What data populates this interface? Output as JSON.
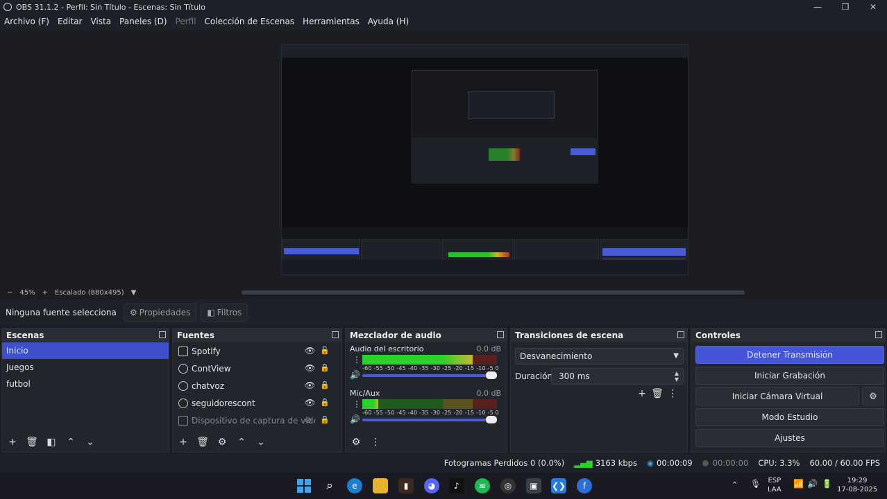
{
  "window": {
    "title": "OBS 31.1.2 - Perfil: Sin Título - Escenas: Sin Título",
    "minimize_icon": "minimize-icon",
    "maximize_icon": "maximize-icon",
    "close_icon": "close-icon"
  },
  "menu": {
    "items": [
      "Archivo (F)",
      "Editar",
      "Vista",
      "Paneles (D)",
      "Perfil",
      "Colección de Escenas",
      "Herramientas",
      "Ayuda (H)"
    ]
  },
  "zoom": {
    "minus": "−",
    "level": "45%",
    "plus": "+",
    "scaling": "Escalado (880x495)"
  },
  "source_toolbar": {
    "no_selection": "Ninguna fuente selecciona",
    "properties": "Propiedades",
    "filters": "Filtros"
  },
  "scenes": {
    "title": "Escenas",
    "items": [
      "Inicio",
      "Juegos",
      "futbol"
    ],
    "selected_index": 0
  },
  "sources": {
    "title": "Fuentes",
    "items": [
      {
        "name": "Spotify",
        "icon": "window-capture-icon",
        "visible": true,
        "locked": false
      },
      {
        "name": "ContView",
        "icon": "browser-source-icon",
        "visible": true,
        "locked": true
      },
      {
        "name": "chatvoz",
        "icon": "browser-source-icon",
        "visible": true,
        "locked": true
      },
      {
        "name": "seguidorescont",
        "icon": "browser-source-icon",
        "visible": true,
        "locked": true
      },
      {
        "name": "Dispositivo de captura de video",
        "icon": "camera-icon",
        "visible": false,
        "locked": true
      }
    ]
  },
  "mixer": {
    "title": "Mezclador de audio",
    "channels": [
      {
        "name": "Audio del escritorio",
        "db": "0.0 dB",
        "level": 0.82
      },
      {
        "name": "Mic/Aux",
        "db": "0.0 dB",
        "level": 0.12
      }
    ],
    "ticks": "-60 -55 -50 -45 -40 -35 -30 -25 -20 -15 -10  -5   0"
  },
  "transitions": {
    "title": "Transiciones de escena",
    "selected": "Desvanecimiento",
    "duration_label": "Duración",
    "duration_value": "300 ms"
  },
  "controls": {
    "title": "Controles",
    "stop_stream": "Detener Transmisión",
    "start_recording": "Iniciar Grabación",
    "start_virtual_cam": "Iniciar Cámara Virtual",
    "studio_mode": "Modo Estudio",
    "settings": "Ajustes"
  },
  "status": {
    "dropped_frames": "Fotogramas Perdidos 0 (0.0%)",
    "bitrate": "3163 kbps",
    "stream_time": "00:00:09",
    "record_time": "00:00:00",
    "cpu": "CPU: 3.3%",
    "fps": "60.00 / 60.00 FPS"
  },
  "taskbar": {
    "lang_top": "ESP",
    "lang_bottom": "LAA",
    "time": "19:29",
    "date": "17-08-2025"
  },
  "colors": {
    "accent": "#4455d6",
    "selection": "#3d50c9",
    "meter_green": "#2bd02b",
    "meter_yellow": "#c7b72d",
    "meter_red": "#c02828"
  }
}
